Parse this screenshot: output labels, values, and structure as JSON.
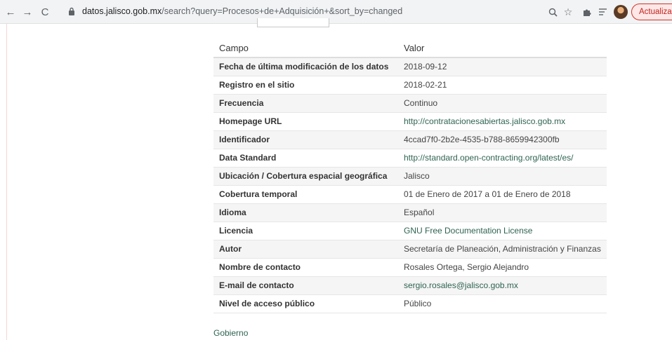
{
  "browser": {
    "back": "←",
    "forward": "→",
    "reload": "C",
    "url_host": "datos.jalisco.gob.mx",
    "url_path": "/search?query=Procesos+de+Adquisición+&sort_by=changed",
    "update_label": "Actualizar"
  },
  "table": {
    "headers": {
      "field": "Campo",
      "value": "Valor"
    },
    "rows": [
      {
        "field": "Fecha de última modificación de los datos",
        "value": "2018-09-12"
      },
      {
        "field": "Registro en el sitio",
        "value": "2018-02-21"
      },
      {
        "field": "Frecuencia",
        "value": "Continuo"
      },
      {
        "field": "Homepage URL",
        "value": "http://contratacionesabiertas.jalisco.gob.mx"
      },
      {
        "field": "Identificador",
        "value": "4ccad7f0-2b2e-4535-b788-8659942300fb"
      },
      {
        "field": "Data Standard",
        "value": "http://standard.open-contracting.org/latest/es/"
      },
      {
        "field": "Ubicación / Cobertura espacial geográfica",
        "value": "Jalisco"
      },
      {
        "field": "Cobertura temporal",
        "value": "01 de Enero de 2017 a 01 de Enero de 2018"
      },
      {
        "field": "Idioma",
        "value": "Español"
      },
      {
        "field": "Licencia",
        "value": "GNU Free Documentation License"
      },
      {
        "field": "Autor",
        "value": "Secretaría de Planeación, Administración y Finanzas"
      },
      {
        "field": "Nombre de contacto",
        "value": "Rosales Ortega, Sergio Alejandro"
      },
      {
        "field": "E-mail de contacto",
        "value": "sergio.rosales@jalisco.gob.mx"
      },
      {
        "field": "Nivel de acceso público",
        "value": "Público"
      }
    ]
  },
  "footer": {
    "link": "Gobierno"
  },
  "colors": {
    "link": "#2f6351",
    "update_border": "#d93025"
  }
}
